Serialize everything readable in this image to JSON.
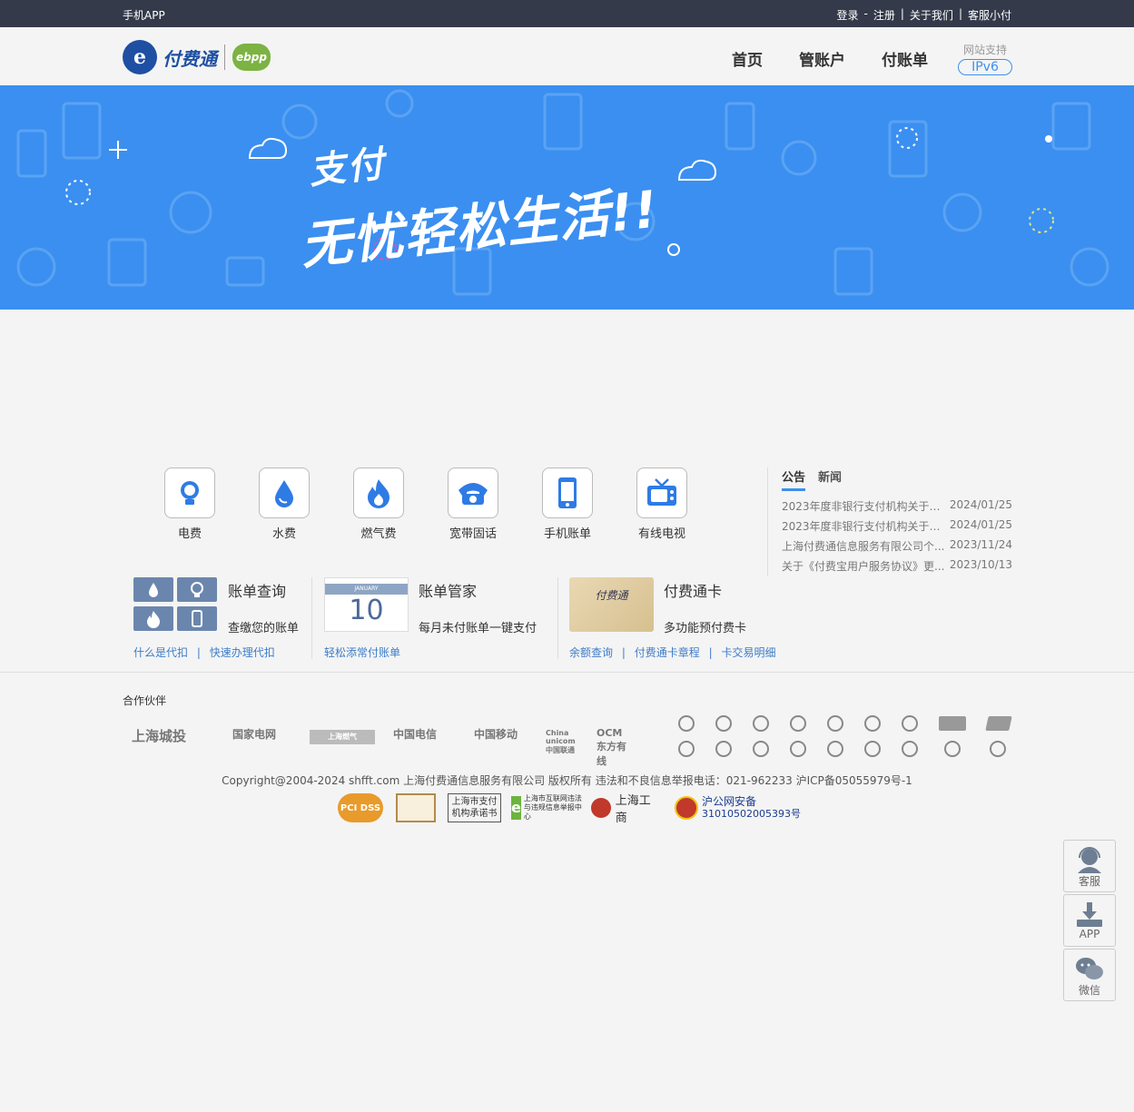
{
  "topbar": {
    "app": "手机APP",
    "login": "登录",
    "dash": "-",
    "register": "注册",
    "sep": "|",
    "about": "关于我们",
    "service": "客服小付"
  },
  "header": {
    "logo_text": "付费通",
    "logo_mark": "e",
    "ebpp": "ebpp",
    "nav": [
      "首页",
      "管账户",
      "付账单"
    ],
    "ipv6_label": "网站支持",
    "ipv6_badge": "IPv6"
  },
  "banner": {
    "line1": "支付",
    "line2": "无忧轻松生活!!"
  },
  "services": [
    {
      "label": "电费",
      "icon": "bulb-icon"
    },
    {
      "label": "水费",
      "icon": "water-drop-icon"
    },
    {
      "label": "燃气费",
      "icon": "flame-icon"
    },
    {
      "label": "宽带固话",
      "icon": "telephone-icon"
    },
    {
      "label": "手机账单",
      "icon": "mobile-phone-icon"
    },
    {
      "label": "有线电视",
      "icon": "tv-icon"
    }
  ],
  "notice": {
    "tabs": [
      "公告",
      "新闻"
    ],
    "items": [
      {
        "title": "2023年度非银行支付机构关于客...",
        "date": "2024/01/25"
      },
      {
        "title": "2023年度非银行支付机构关于风...",
        "date": "2024/01/25"
      },
      {
        "title": "上海付费通信息服务有限公司个...",
        "date": "2023/11/24"
      },
      {
        "title": "关于《付费宝用户服务协议》更...",
        "date": "2023/10/13"
      }
    ]
  },
  "features": {
    "query": {
      "title": "账单查询",
      "desc": "查缴您的账单",
      "links": [
        "什么是代扣",
        "快速办理代扣"
      ]
    },
    "manager": {
      "title": "账单管家",
      "desc": "每月未付账单一键支付",
      "links": [
        "轻松添常付账单"
      ],
      "calendar_month": "JANUARY",
      "calendar_day": "10"
    },
    "card": {
      "title": "付费通卡",
      "desc": "多功能预付费卡",
      "links": [
        "余额查询",
        "付费通卡章程",
        "卡交易明细"
      ],
      "card_text": "付费通"
    }
  },
  "partners": {
    "title": "合作伙伴",
    "logos": [
      "上海城投",
      "国家电网",
      "上海燃气",
      "中国电信",
      "中国移动",
      "China unicom中国联通",
      "OCM 东方有线"
    ]
  },
  "footer": {
    "copyright": "Copyright@2004-2024 shfft.com 上海付费通信息服务有限公司 版权所有  违法和不良信息举报电话：021-962233  沪ICP备05055979号-1",
    "badges": [
      "PCI DSS",
      "",
      "上海市支付机构承诺书",
      "上海市互联网违法与违规信息举报中心",
      "上海工商"
    ],
    "police_title": "沪公网安备",
    "police_no": "31010502005393号"
  },
  "side": [
    {
      "label": "客服",
      "icon": "customer-service-icon"
    },
    {
      "label": "APP",
      "icon": "download-icon"
    },
    {
      "label": "微信",
      "icon": "wechat-icon"
    }
  ],
  "colors": {
    "topbar": "#343a4a",
    "banner": "#3b8ff0",
    "accent": "#3d8ff0",
    "link": "#3d7cc9",
    "tile": "#6b86ad"
  }
}
